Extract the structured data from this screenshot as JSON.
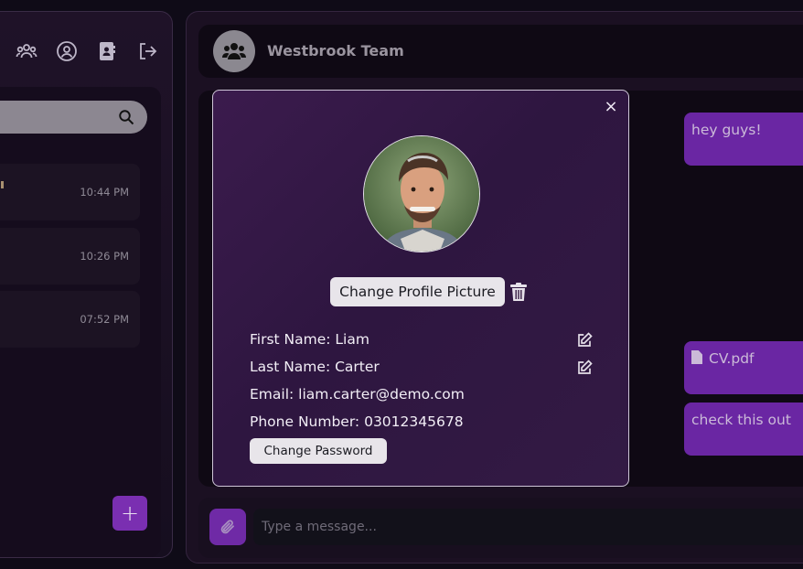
{
  "sidebar": {
    "top_icons": [
      "users-group-icon",
      "user-circle-icon",
      "contact-book-icon",
      "logout-icon"
    ],
    "chats": [
      {
        "time": "10:44 PM"
      },
      {
        "time": "10:26 PM"
      },
      {
        "time": "07:52 PM"
      }
    ],
    "add_label": "+"
  },
  "chat": {
    "title": "Westbrook Team",
    "messages": [
      {
        "text": "hey guys!"
      },
      {
        "text": "CV.pdf",
        "type": "file"
      },
      {
        "text": "check this out"
      }
    ],
    "input_placeholder": "Type a message..."
  },
  "modal": {
    "close_label": "×",
    "change_picture_label": "Change Profile Picture",
    "fields": {
      "first_name": "First Name: Liam",
      "last_name": "Last Name: Carter",
      "email": "Email: liam.carter@demo.com",
      "phone": "Phone Number: 03012345678"
    },
    "change_password_label": "Change Password"
  },
  "colors": {
    "accent": "#7a2fb1",
    "bubble": "#6a26a3",
    "modal_bg": "#2e1640"
  }
}
